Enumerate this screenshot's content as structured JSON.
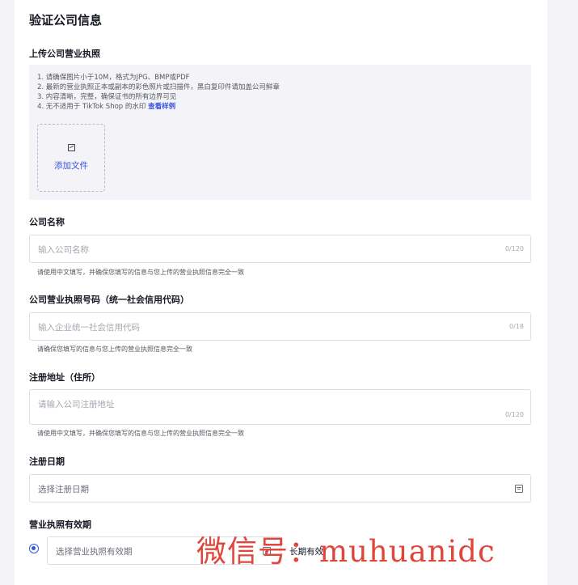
{
  "page_title": "验证公司信息",
  "upload": {
    "label": "上传公司营业执照",
    "instructions": [
      "1. 请确保图片小于10M，格式为JPG、BMP或PDF",
      "2. 最新的营业执照正本或副本的彩色照片或扫描件，黑白复印件请加盖公司鲜章",
      "3. 内容清晰，完整，确保证书的所有边界可见"
    ],
    "instruction_4_prefix": "4. 无不适用于 TikTok Shop 的水印",
    "sample_link": "查看样例",
    "add_file_label": "添加文件"
  },
  "company_name": {
    "label": "公司名称",
    "placeholder": "输入公司名称",
    "counter": "0/120",
    "hint": "请使用中文填写，并确保您填写的信息与您上传的营业执照信息完全一致"
  },
  "license_number": {
    "label": "公司营业执照号码（统一社会信用代码）",
    "placeholder": "输入企业统一社会信用代码",
    "counter": "0/18",
    "hint": "请确保您填写的信息与您上传的营业执照信息完全一致"
  },
  "address": {
    "label": "注册地址（住所）",
    "placeholder": "请输入公司注册地址",
    "counter": "0/120",
    "hint": "请使用中文填写，并确保您填写的信息与您上传的营业执照信息完全一致"
  },
  "reg_date": {
    "label": "注册日期",
    "placeholder": "选择注册日期"
  },
  "validity": {
    "label": "营业执照有效期",
    "placeholder": "选择营业执照有效期",
    "long_term_label": "长期有效"
  },
  "watermark": "微信号：muhuanidc",
  "colors": {
    "accent": "#3555e0",
    "watermark": "#e0463c"
  },
  "icons": {
    "upload": "image-icon",
    "calendar": "calendar-icon",
    "radio": "radio-selected"
  }
}
